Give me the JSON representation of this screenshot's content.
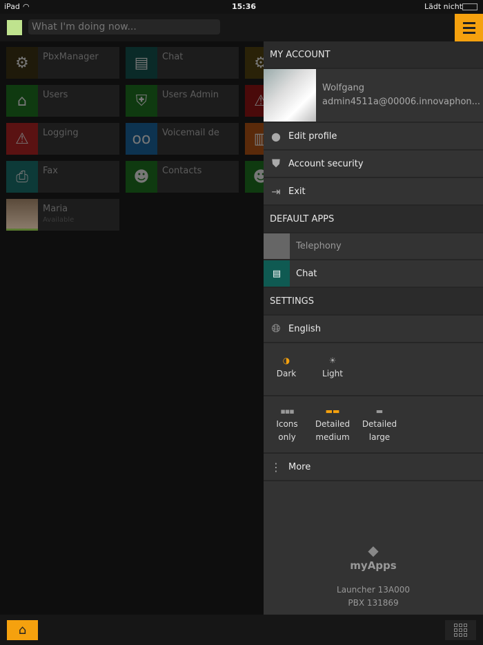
{
  "status_bar": {
    "device": "iPad",
    "time": "15:36",
    "battery_text": "Lädt nicht"
  },
  "header": {
    "presence_color": "#bfe38e",
    "doing_placeholder": "What I'm doing now...",
    "menu_icon": "hamburger-icon"
  },
  "tiles": [
    {
      "label": "PbxManager",
      "icon": "pbx-gear-icon",
      "color": "#1f1a0a"
    },
    {
      "label": "Chat",
      "icon": "chat-icon",
      "color": "#0a2a28"
    },
    {
      "label": "Users",
      "icon": "users-house-icon",
      "color": "#0f3a10"
    },
    {
      "label": "Users Admin",
      "icon": "users-admin-icon",
      "color": "#0f3a10"
    },
    {
      "label": "Logging",
      "icon": "logging-warning-icon",
      "color": "#5a1212"
    },
    {
      "label": "Voicemail de",
      "icon": "voicemail-icon",
      "color": "#0d3350"
    },
    {
      "label": "Fax",
      "icon": "fax-icon",
      "color": "#0d3a38"
    },
    {
      "label": "Contacts",
      "icon": "contacts-icon",
      "color": "#0f3a10"
    },
    {
      "label": "Maria",
      "sub": "Available",
      "icon": "avatar"
    }
  ],
  "panel": {
    "my_account": "MY ACCOUNT",
    "user": {
      "name": "Wolfgang",
      "email": "admin4511a@00006.innovaphon..."
    },
    "edit_profile": "Edit profile",
    "account_security": "Account security",
    "exit": "Exit",
    "default_apps": "DEFAULT APPS",
    "telephony": "Telephony",
    "chat": "Chat",
    "settings": "SETTINGS",
    "language": "English",
    "theme": {
      "dark": "Dark",
      "light": "Light",
      "selected": "Dark"
    },
    "layout": {
      "icons_only": [
        "Icons",
        "only"
      ],
      "detailed_medium": [
        "Detailed",
        "medium"
      ],
      "detailed_large": [
        "Detailed",
        "large"
      ],
      "selected": "Detailed medium"
    },
    "more": "More",
    "logo": "myApps",
    "launcher": "Launcher 13A000",
    "pbx": "PBX 131869"
  },
  "accent": "#f5a10e"
}
